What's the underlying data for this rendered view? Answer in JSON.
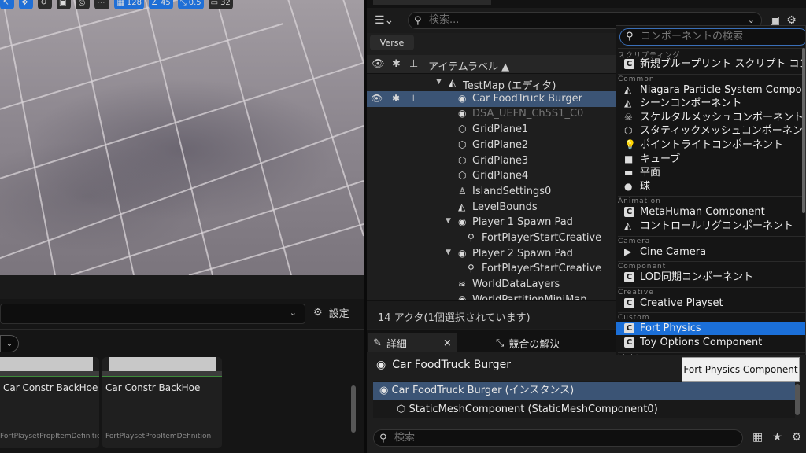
{
  "viewport": {
    "toolbar": [
      {
        "icon": "select-icon",
        "text": "",
        "active": true
      },
      {
        "icon": "move-icon",
        "text": "",
        "active": true
      },
      {
        "icon": "rotate-icon",
        "text": "",
        "active": false
      },
      {
        "icon": "scale-icon",
        "text": "",
        "active": false
      },
      {
        "icon": "world-icon",
        "text": "",
        "active": false
      },
      {
        "icon": "surface-snap-icon",
        "text": "",
        "active": false
      },
      {
        "icon": "grid-snap-icon",
        "text": "128",
        "active": true
      },
      {
        "icon": "rotation-snap-icon",
        "text": "45",
        "active": true
      },
      {
        "icon": "scale-snap-icon",
        "text": "0.5",
        "active": true
      },
      {
        "icon": "camera-speed-icon",
        "text": "32",
        "active": false
      }
    ]
  },
  "content_browser": {
    "settings_label": "設定",
    "tiles": [
      {
        "name": "Car Constr BackHoe",
        "type": "FortPlaysetPropItemDefinition"
      },
      {
        "name": "Car Constr BackHoe",
        "type": "FortPlaysetPropItemDefinition"
      }
    ]
  },
  "outliner": {
    "search_placeholder": "検索...",
    "verse_label": "Verse",
    "column_label": "アイテムラベル ▲",
    "rows": [
      {
        "label": "TestMap (エディタ)",
        "icon": "map-icon",
        "glyph": "◭",
        "indent": 1,
        "arrow": "▼",
        "selected": false,
        "dim": false
      },
      {
        "label": "Car FoodTruck Burger",
        "icon": "actor-icon",
        "glyph": "◉",
        "indent": 2,
        "arrow": "",
        "selected": true,
        "dim": false
      },
      {
        "label": "DSA_UEFN_Ch5S1_C0",
        "icon": "actor-icon",
        "glyph": "◉",
        "indent": 2,
        "arrow": "",
        "selected": false,
        "dim": true
      },
      {
        "label": "GridPlane1",
        "icon": "static-mesh-icon",
        "glyph": "⬡",
        "indent": 2,
        "arrow": "",
        "selected": false,
        "dim": false
      },
      {
        "label": "GridPlane2",
        "icon": "static-mesh-icon",
        "glyph": "⬡",
        "indent": 2,
        "arrow": "",
        "selected": false,
        "dim": false
      },
      {
        "label": "GridPlane3",
        "icon": "static-mesh-icon",
        "glyph": "⬡",
        "indent": 2,
        "arrow": "",
        "selected": false,
        "dim": false
      },
      {
        "label": "GridPlane4",
        "icon": "static-mesh-icon",
        "glyph": "⬡",
        "indent": 2,
        "arrow": "",
        "selected": false,
        "dim": false
      },
      {
        "label": "IslandSettings0",
        "icon": "island-settings-icon",
        "glyph": "♙",
        "indent": 2,
        "arrow": "",
        "selected": false,
        "dim": false
      },
      {
        "label": "LevelBounds",
        "icon": "level-bounds-icon",
        "glyph": "◭",
        "indent": 2,
        "arrow": "",
        "selected": false,
        "dim": false
      },
      {
        "label": "Player 1 Spawn Pad",
        "icon": "actor-icon",
        "glyph": "◉",
        "indent": 2,
        "arrow": "▼",
        "selected": false,
        "dim": false
      },
      {
        "label": "FortPlayerStartCreative",
        "icon": "player-start-icon",
        "glyph": "⚲",
        "indent": 3,
        "arrow": "",
        "selected": false,
        "dim": false
      },
      {
        "label": "Player 2 Spawn Pad",
        "icon": "actor-icon",
        "glyph": "◉",
        "indent": 2,
        "arrow": "▼",
        "selected": false,
        "dim": false
      },
      {
        "label": "FortPlayerStartCreative",
        "icon": "player-start-icon",
        "glyph": "⚲",
        "indent": 3,
        "arrow": "",
        "selected": false,
        "dim": false
      },
      {
        "label": "WorldDataLayers",
        "icon": "layers-icon",
        "glyph": "≋",
        "indent": 2,
        "arrow": "",
        "selected": false,
        "dim": false
      },
      {
        "label": "WorldPartitionMiniMap",
        "icon": "actor-icon",
        "glyph": "◉",
        "indent": 2,
        "arrow": "",
        "selected": false,
        "dim": false
      }
    ],
    "status": "14 アクタ(1個選択されています)"
  },
  "details": {
    "tab_details": "詳細",
    "tab_merge": "競合の解決",
    "actor_name": "Car FoodTruck Burger",
    "components": [
      {
        "label": "Car FoodTruck Burger (インスタンス)",
        "selected": true,
        "indent": 0,
        "icon": "actor-icon",
        "glyph": "◉"
      },
      {
        "label": "StaticMeshComponent (StaticMeshComponent0)",
        "selected": false,
        "indent": 1,
        "icon": "static-mesh-icon",
        "glyph": "⬡"
      }
    ],
    "search_placeholder": "検索"
  },
  "add_component_menu": {
    "search_placeholder": "コンポーネントの検索",
    "sections": [
      {
        "category": "スクリプティング",
        "items": [
          {
            "label": "新規ブループリント スクリプト コンポ",
            "icon": "class-icon",
            "glyph": "C",
            "highlight": false
          }
        ]
      },
      {
        "category": "Common",
        "items": [
          {
            "label": "Niagara Particle System Componen",
            "icon": "niagara-icon",
            "glyph": "◭",
            "highlight": false
          },
          {
            "label": "シーンコンポーネント",
            "icon": "scene-icon",
            "glyph": "◭",
            "highlight": false
          },
          {
            "label": "スケルタルメッシュコンポーネント",
            "icon": "skeleton-icon",
            "glyph": "☠",
            "highlight": false
          },
          {
            "label": "スタティックメッシュコンポーネント",
            "icon": "static-mesh-icon",
            "glyph": "⬡",
            "highlight": false
          },
          {
            "label": "ポイントライトコンポーネント",
            "icon": "light-bulb-icon",
            "glyph": "💡",
            "highlight": false
          },
          {
            "label": "キューブ",
            "icon": "cube-icon",
            "glyph": "■",
            "highlight": false
          },
          {
            "label": "平面",
            "icon": "plane-icon",
            "glyph": "▬",
            "highlight": false
          },
          {
            "label": "球",
            "icon": "sphere-icon",
            "glyph": "●",
            "highlight": false
          }
        ]
      },
      {
        "category": "Animation",
        "items": [
          {
            "label": "MetaHuman Component",
            "icon": "class-icon",
            "glyph": "C",
            "highlight": false
          },
          {
            "label": "コントロールリグコンポーネント",
            "icon": "control-rig-icon",
            "glyph": "◭",
            "highlight": false
          }
        ]
      },
      {
        "category": "Camera",
        "items": [
          {
            "label": "Cine Camera",
            "icon": "camera-icon",
            "glyph": "▶",
            "highlight": false
          }
        ]
      },
      {
        "category": "Component",
        "items": [
          {
            "label": "LOD同期コンポーネント",
            "icon": "class-icon",
            "glyph": "C",
            "highlight": false
          }
        ]
      },
      {
        "category": "Creative",
        "items": [
          {
            "label": "Creative Playset",
            "icon": "class-icon",
            "glyph": "C",
            "highlight": false
          }
        ]
      },
      {
        "category": "Custom",
        "items": [
          {
            "label": "Fort Physics",
            "icon": "class-icon",
            "glyph": "C",
            "highlight": true
          },
          {
            "label": "Toy Options Component",
            "icon": "class-icon",
            "glyph": "C",
            "highlight": false
          }
        ]
      },
      {
        "category": "Lights",
        "items": []
      }
    ]
  },
  "tooltip": {
    "text": "Fort Physics Component"
  },
  "colors": {
    "accent": "#1b6fd8",
    "selection": "#3b5475",
    "panel": "#1e1e1e",
    "tooltip": "#f0f0f0"
  }
}
